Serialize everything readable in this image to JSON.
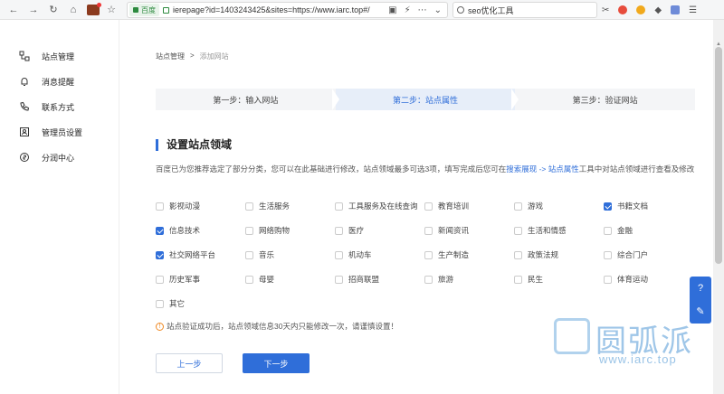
{
  "browser": {
    "url_badge": "百度",
    "url": "ierepage?id=1403243425&sites=https://www.iarc.top#/",
    "search": "seo优化工具"
  },
  "sidebar": {
    "items": [
      {
        "label": "站点管理",
        "icon": "sitemap-icon"
      },
      {
        "label": "消息提醒",
        "icon": "bell-icon"
      },
      {
        "label": "联系方式",
        "icon": "phone-icon"
      },
      {
        "label": "管理员设置",
        "icon": "admin-icon"
      },
      {
        "label": "分润中心",
        "icon": "coin-icon"
      }
    ]
  },
  "breadcrumb": {
    "root": "站点管理",
    "sep": ">",
    "current": "添加网站"
  },
  "steps": [
    "第一步：输入网站",
    "第二步：站点属性",
    "第三步：验证网站"
  ],
  "active_step": 1,
  "section_title": "设置站点领域",
  "description": {
    "part1": "百度已为您推荐选定了部分分类，您可以在此基础进行修改，站点领域最多可选3项，填写完成后您可在",
    "link": "搜索展现 -> 站点属性",
    "part2": "工具中对站点领域进行查看及修改"
  },
  "categories": [
    {
      "label": "影视动漫",
      "checked": false
    },
    {
      "label": "生活服务",
      "checked": false
    },
    {
      "label": "工具服务及在线查询",
      "checked": false
    },
    {
      "label": "教育培训",
      "checked": false
    },
    {
      "label": "游戏",
      "checked": false
    },
    {
      "label": "书籍文档",
      "checked": true
    },
    {
      "label": "信息技术",
      "checked": true
    },
    {
      "label": "网络购物",
      "checked": false
    },
    {
      "label": "医疗",
      "checked": false
    },
    {
      "label": "新闻资讯",
      "checked": false
    },
    {
      "label": "生活和情感",
      "checked": false
    },
    {
      "label": "金融",
      "checked": false
    },
    {
      "label": "社交网络平台",
      "checked": true
    },
    {
      "label": "音乐",
      "checked": false
    },
    {
      "label": "机动车",
      "checked": false
    },
    {
      "label": "生产制造",
      "checked": false
    },
    {
      "label": "政策法规",
      "checked": false
    },
    {
      "label": "综合门户",
      "checked": false
    },
    {
      "label": "历史军事",
      "checked": false
    },
    {
      "label": "母婴",
      "checked": false
    },
    {
      "label": "招商联盟",
      "checked": false
    },
    {
      "label": "旅游",
      "checked": false
    },
    {
      "label": "民生",
      "checked": false
    },
    {
      "label": "体育运动",
      "checked": false
    },
    {
      "label": "其它",
      "checked": false
    }
  ],
  "notice": "站点验证成功后，站点领域信息30天内只能修改一次，请谨慎设置！",
  "buttons": {
    "prev": "上一步",
    "next": "下一步"
  },
  "watermark": {
    "text": "圆弧派",
    "url": "www.iarc.top"
  },
  "colors": {
    "primary": "#2f6ed9",
    "warning": "#f08a24"
  }
}
